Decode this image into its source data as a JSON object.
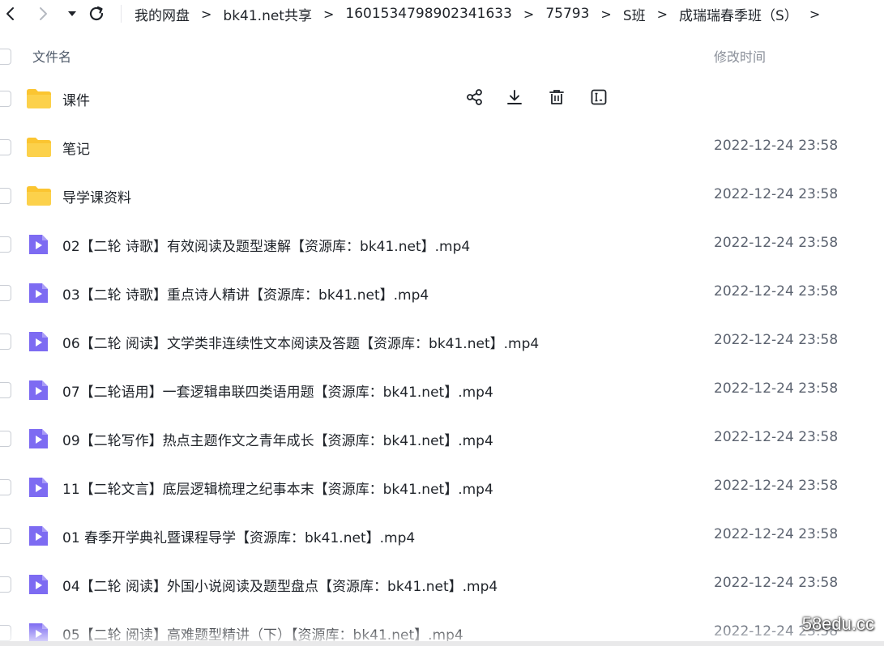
{
  "toolbar": {
    "breadcrumb": [
      "我的网盘",
      "bk41.net共享",
      "1601534798902341633",
      "75793",
      "S班",
      "成瑞瑞春季班（S）"
    ],
    "separator": ">"
  },
  "header": {
    "name_label": "文件名",
    "time_label": "修改时间"
  },
  "files": [
    {
      "type": "folder",
      "name": "课件",
      "time": ""
    },
    {
      "type": "folder",
      "name": "笔记",
      "time": "2022-12-24 23:58"
    },
    {
      "type": "folder",
      "name": "导学课资料",
      "time": "2022-12-24 23:58"
    },
    {
      "type": "video",
      "name": "02【二轮 诗歌】有效阅读及题型速解【资源库：bk41.net】.mp4",
      "time": "2022-12-24 23:58"
    },
    {
      "type": "video",
      "name": "03【二轮 诗歌】重点诗人精讲【资源库：bk41.net】.mp4",
      "time": "2022-12-24 23:58"
    },
    {
      "type": "video",
      "name": "06【二轮 阅读】文学类非连续性文本阅读及答题【资源库：bk41.net】.mp4",
      "time": "2022-12-24 23:58"
    },
    {
      "type": "video",
      "name": "07【二轮语用】一套逻辑串联四类语用题【资源库：bk41.net】.mp4",
      "time": "2022-12-24 23:58"
    },
    {
      "type": "video",
      "name": "09【二轮写作】热点主题作文之青年成长【资源库：bk41.net】.mp4",
      "time": "2022-12-24 23:58"
    },
    {
      "type": "video",
      "name": "11【二轮文言】底层逻辑梳理之纪事本末【资源库：bk41.net】.mp4",
      "time": "2022-12-24 23:58"
    },
    {
      "type": "video",
      "name": "01 春季开学典礼暨课程导学【资源库：bk41.net】.mp4",
      "time": "2022-12-24 23:58"
    },
    {
      "type": "video",
      "name": "04【二轮 阅读】外国小说阅读及题型盘点【资源库：bk41.net】.mp4",
      "time": "2022-12-24 23:58"
    },
    {
      "type": "video",
      "name": "05【二轮 阅读】高难题型精讲（下）【资源库：bk41.net】.mp4",
      "time": "2022-12-24 23:58"
    }
  ],
  "watermark": "58edu.cc",
  "colors": {
    "folder": "#fbc531",
    "video": "#7d6bf2",
    "text": "#1f2329",
    "muted": "#5c6370"
  },
  "icons": {
    "share": "share-icon",
    "download": "download-icon",
    "delete": "trash-icon",
    "rename": "rename-icon"
  }
}
